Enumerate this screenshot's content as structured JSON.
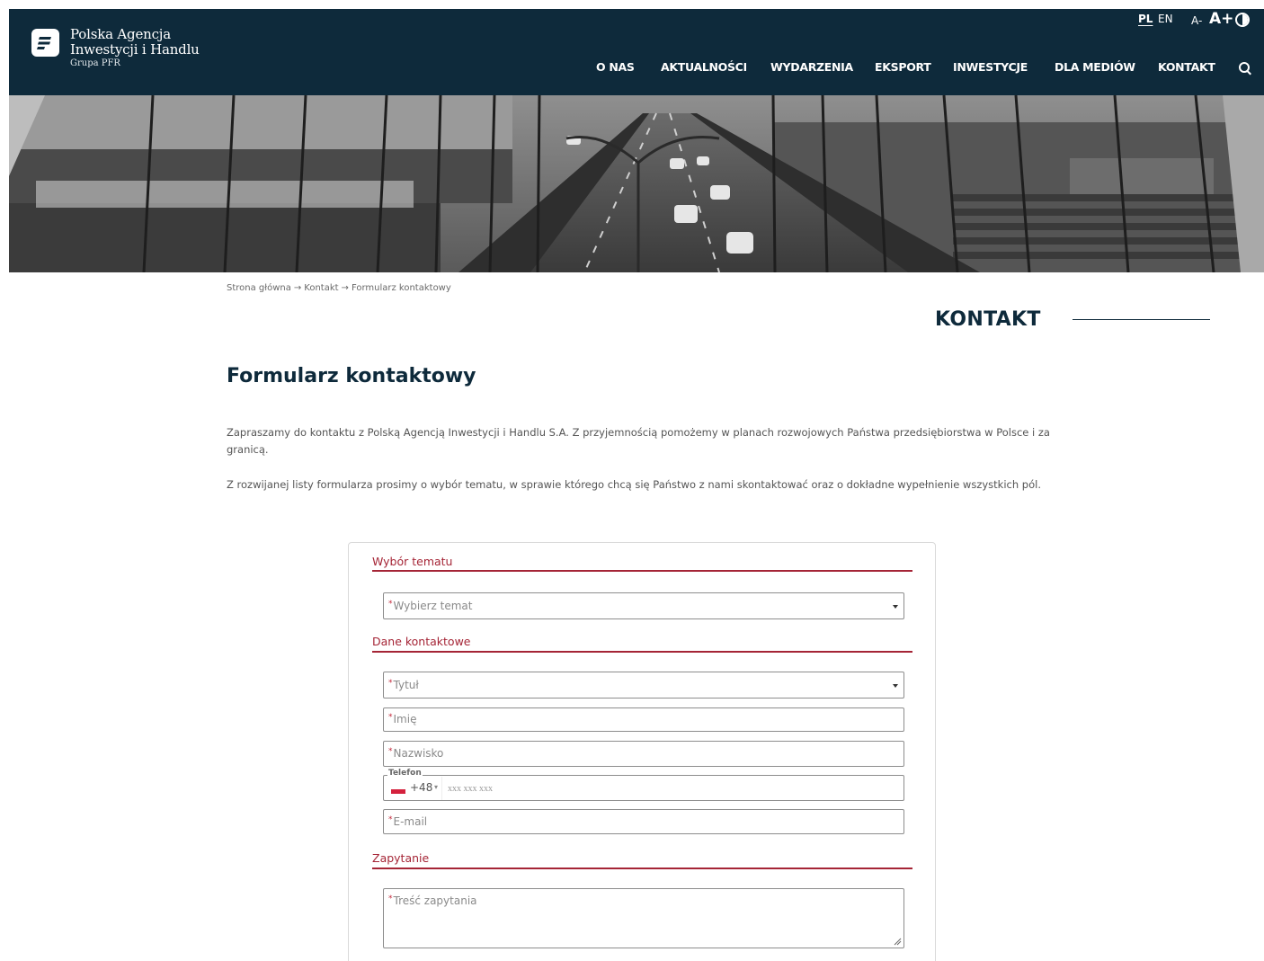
{
  "header": {
    "logo_line1": "Polska Agencja",
    "logo_line2": "Inwestycji i Handlu",
    "logo_sub": "Grupa PFR",
    "lang_pl": "PL",
    "lang_en": "EN",
    "font_smaller": "A-",
    "font_bigger": "A+",
    "nav": [
      "O NAS",
      "AKTUALNOŚCI",
      "WYDARZENIA",
      "EKSPORT",
      "INWESTYCJE",
      "DLA MEDIÓW",
      "KONTAKT"
    ]
  },
  "breadcrumb": [
    "Strona główna",
    "Kontakt",
    "Formularz kontaktowy"
  ],
  "breadcrumb_sep": "→",
  "section_title": "KONTAKT",
  "page_title": "Formularz kontaktowy",
  "intro": [
    "Zapraszamy do kontaktu z Polską Agencją Inwestycji i Handlu S.A. Z przyjemnością pomożemy w planach rozwojowych Państwa przedsiębiorstwa w Polsce i za granicą.",
    "Z rozwijanej listy formularza prosimy o wybór tematu, w sprawie którego chcą się Państwo z nami skontaktować oraz o dokładne wypełnienie wszystkich pól."
  ],
  "form": {
    "required_mark": "*",
    "group_topic": "Wybór tematu",
    "topic_placeholder": "Wybierz temat",
    "group_contact": "Dane kontaktowe",
    "title_placeholder": "Tytuł",
    "first_name_placeholder": "Imię",
    "last_name_placeholder": "Nazwisko",
    "phone_legend": "Telefon",
    "phone_dial": "+48",
    "phone_dial_caret": "▾",
    "phone_placeholder": "xxx xxx xxx",
    "email_placeholder": "E-mail",
    "group_query": "Zapytanie",
    "query_placeholder": "Treść zapytania"
  },
  "colors": {
    "header_bg": "#0e2a3b",
    "accent_red": "#a52536",
    "required_red": "#c3283a"
  }
}
